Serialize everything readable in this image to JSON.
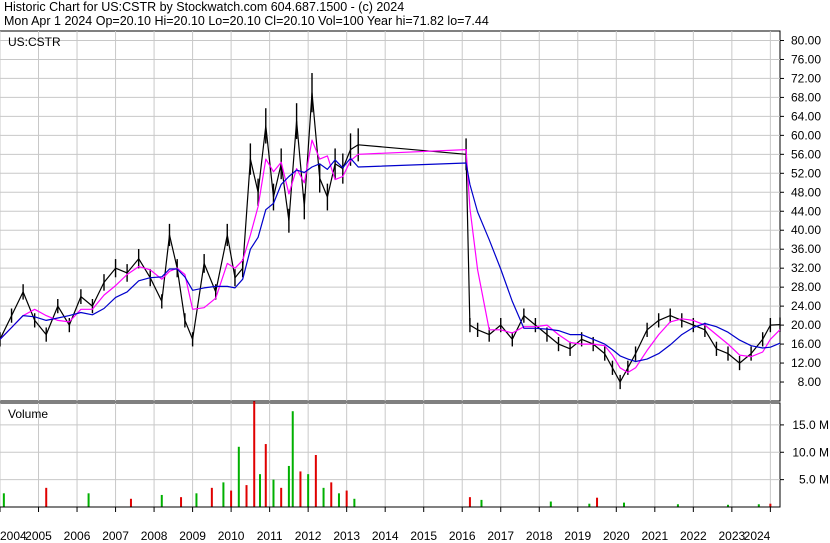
{
  "header": {
    "line1": "Historic Chart for US:CSTR by Stockwatch.com 604.687.1500 - (c) 2024",
    "line2": "Mon Apr  1 2024   Op=20.10   Hi=20.10   Lo=20.10   Cl=20.10   Vol=100   Year hi=71.82   lo=7.44"
  },
  "chart_data": [
    {
      "type": "line",
      "panel": "price",
      "symbol_label": "US:CSTR",
      "ylim": [
        4,
        82
      ],
      "yticks": [
        "8.00",
        "12.00",
        "16.00",
        "20.00",
        "24.00",
        "28.00",
        "32.00",
        "36.00",
        "40.00",
        "44.00",
        "48.00",
        "52.00",
        "56.00",
        "60.00",
        "64.00",
        "68.00",
        "72.00",
        "76.00",
        "80.00"
      ],
      "grid": true,
      "colors": {
        "price_bars": "#000000",
        "ma_short": "#ff00ff",
        "ma_long": "#0000cc",
        "grid": "#c8c8c8"
      },
      "x": [
        2004.0,
        2004.3,
        2004.6,
        2004.9,
        2005.2,
        2005.5,
        2005.8,
        2006.1,
        2006.4,
        2006.7,
        2007.0,
        2007.3,
        2007.6,
        2007.9,
        2008.2,
        2008.4,
        2008.6,
        2008.8,
        2009.0,
        2009.3,
        2009.6,
        2009.9,
        2010.1,
        2010.3,
        2010.5,
        2010.7,
        2010.9,
        2011.1,
        2011.3,
        2011.5,
        2011.7,
        2011.9,
        2012.1,
        2012.3,
        2012.5,
        2012.7,
        2012.9,
        2013.1,
        2013.3,
        2016.1,
        2016.2,
        2016.4,
        2016.7,
        2017.0,
        2017.3,
        2017.6,
        2017.9,
        2018.2,
        2018.5,
        2018.8,
        2019.1,
        2019.4,
        2019.7,
        2019.9,
        2020.1,
        2020.3,
        2020.5,
        2020.8,
        2021.1,
        2021.4,
        2021.7,
        2022.0,
        2022.3,
        2022.6,
        2022.9,
        2023.2,
        2023.5,
        2023.8,
        2024.0,
        2024.25
      ],
      "series": [
        {
          "values": [
            17,
            22,
            27,
            21,
            18,
            24,
            20,
            26,
            24,
            29,
            32,
            31,
            34,
            30,
            25,
            39,
            32,
            21,
            17,
            33,
            27,
            39,
            30,
            32,
            55,
            48,
            62,
            47,
            54,
            42,
            63,
            45,
            69,
            51,
            47,
            54,
            53,
            57,
            58,
            56,
            20,
            19,
            18,
            20,
            17,
            22,
            20,
            18,
            16,
            15,
            17,
            16,
            14,
            11,
            8,
            11,
            14,
            19,
            21,
            22,
            21,
            20,
            19,
            15,
            14,
            12,
            14,
            17,
            20,
            20.1
          ]
        }
      ]
    },
    {
      "type": "bar",
      "panel": "volume",
      "panel_label": "Volume",
      "ylim": [
        0,
        19
      ],
      "yticks": [
        "5.0 M",
        "10.0 M",
        "15.0 M"
      ],
      "colors": {
        "up": "#00b000",
        "down": "#e00000"
      },
      "x": [
        2004.1,
        2005.2,
        2006.3,
        2007.4,
        2008.2,
        2008.7,
        2009.1,
        2009.5,
        2009.8,
        2010.0,
        2010.2,
        2010.4,
        2010.6,
        2010.75,
        2010.9,
        2011.1,
        2011.3,
        2011.5,
        2011.6,
        2011.8,
        2012.0,
        2012.2,
        2012.4,
        2012.6,
        2012.8,
        2013.0,
        2013.2,
        2016.2,
        2016.5,
        2018.3,
        2019.3,
        2019.5,
        2020.2,
        2021.6,
        2022.9,
        2023.7,
        2024.0
      ],
      "volumes": [
        2.5,
        3.5,
        2.5,
        1.5,
        2.2,
        1.8,
        2.5,
        3.5,
        4.5,
        3.0,
        11.0,
        4.0,
        19.3,
        6.0,
        11.5,
        5.0,
        3.5,
        7.5,
        17.5,
        6.5,
        6.0,
        9.5,
        3.5,
        4.5,
        2.5,
        3.0,
        1.5,
        1.8,
        1.3,
        1.0,
        0.6,
        1.7,
        0.8,
        0.5,
        0.4,
        0.5,
        0.6
      ],
      "direction": [
        "up",
        "down",
        "up",
        "down",
        "up",
        "down",
        "up",
        "down",
        "up",
        "down",
        "up",
        "down",
        "down",
        "up",
        "down",
        "up",
        "down",
        "up",
        "up",
        "down",
        "up",
        "down",
        "up",
        "down",
        "up",
        "down",
        "up",
        "down",
        "up",
        "up",
        "up",
        "down",
        "up",
        "up",
        "up",
        "up",
        "down"
      ]
    }
  ],
  "x_axis": {
    "labels": [
      "2004",
      "2005",
      "2006",
      "2007",
      "2008",
      "2009",
      "2010",
      "2011",
      "2012",
      "2013",
      "2014",
      "2015",
      "2016",
      "2017",
      "2018",
      "2019",
      "2020",
      "2021",
      "2022",
      "2023",
      "2024"
    ],
    "range": [
      2004.0,
      2024.25
    ]
  }
}
